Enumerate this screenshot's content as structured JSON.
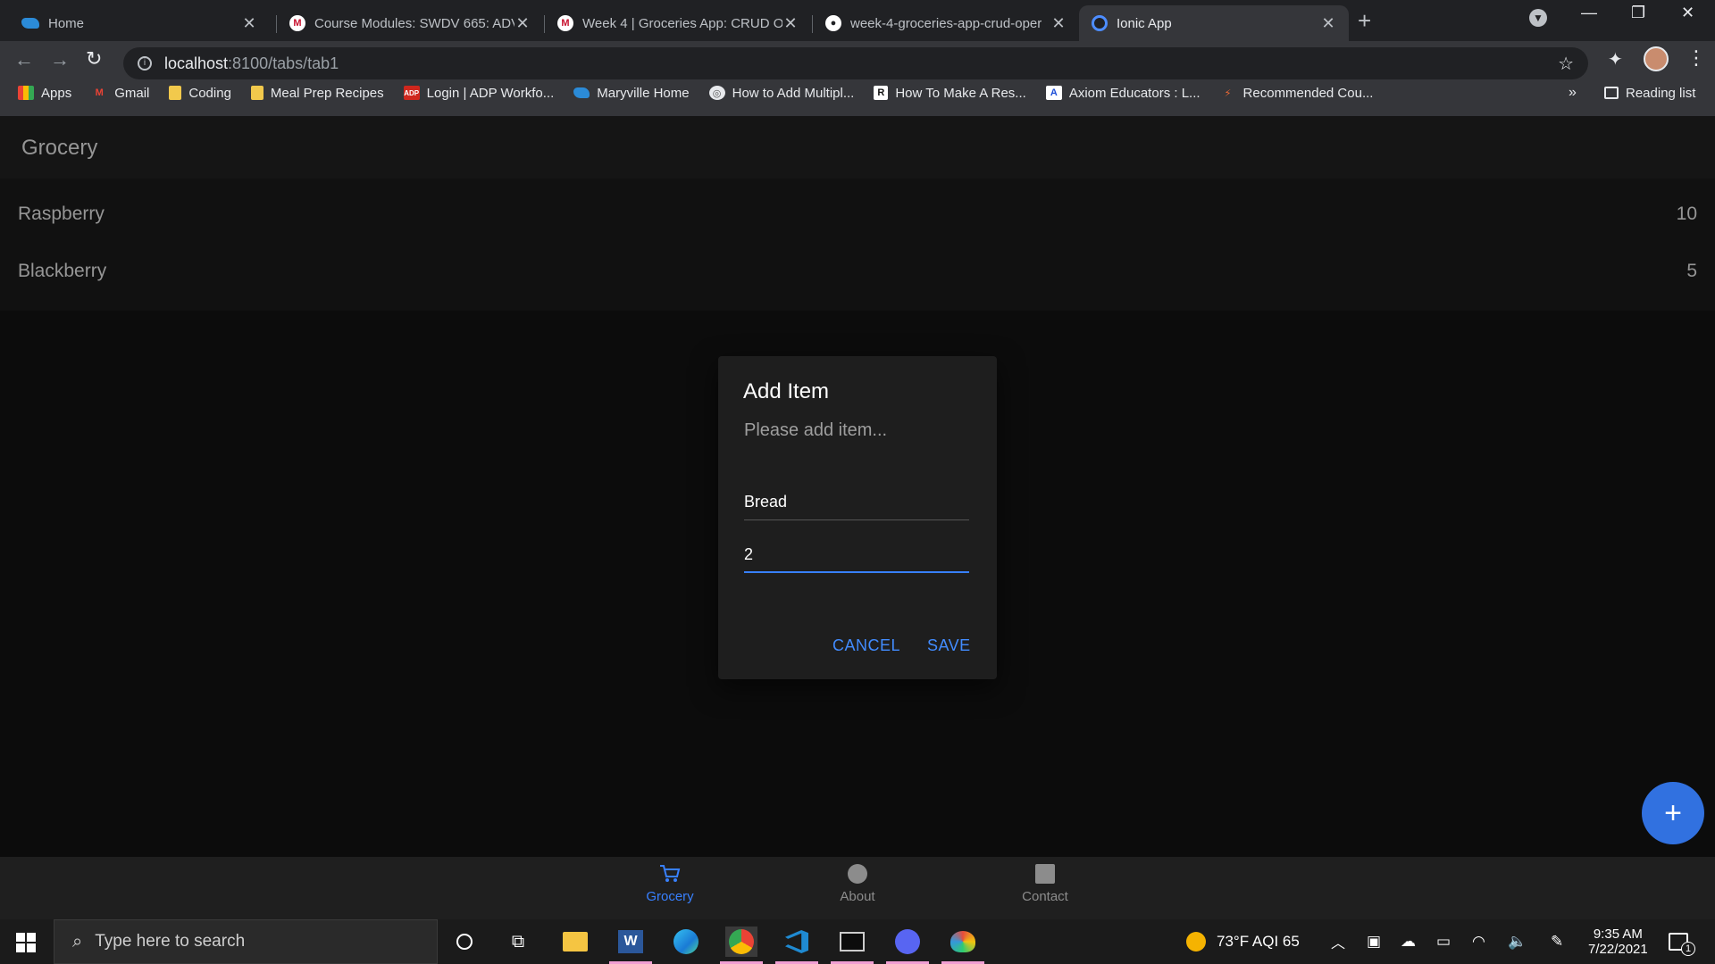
{
  "browser": {
    "tabs": [
      {
        "title": "Home",
        "active": false,
        "favicon": "cloud-icon"
      },
      {
        "title": "Course Modules: SWDV 665: ADV",
        "active": false,
        "favicon": "maryville-icon"
      },
      {
        "title": "Week 4 | Groceries App: CRUD Op",
        "active": false,
        "favicon": "maryville-icon"
      },
      {
        "title": "week-4-groceries-app-crud-oper",
        "active": false,
        "favicon": "github-icon"
      },
      {
        "title": "Ionic App",
        "active": true,
        "favicon": "ionic-icon"
      }
    ],
    "url_host": "localhost",
    "url_path": ":8100/tabs/tab1",
    "bookmarks": [
      {
        "label": "Apps",
        "icon": "apps-grid-icon"
      },
      {
        "label": "Gmail",
        "icon": "gmail-icon"
      },
      {
        "label": "Coding",
        "icon": "folder-icon"
      },
      {
        "label": "Meal Prep Recipes",
        "icon": "folder-icon"
      },
      {
        "label": "Login | ADP Workfo...",
        "icon": "adp-icon"
      },
      {
        "label": "Maryville Home",
        "icon": "cloud-icon"
      },
      {
        "label": "How to Add Multipl...",
        "icon": "site-icon"
      },
      {
        "label": "How To Make A Res...",
        "icon": "r-icon"
      },
      {
        "label": "Axiom Educators : L...",
        "icon": "axiom-icon"
      },
      {
        "label": "Recommended Cou...",
        "icon": "bolt-icon"
      }
    ],
    "more_bookmarks": "»",
    "reading_list": "Reading list"
  },
  "app": {
    "title": "Grocery",
    "items": [
      {
        "name": "Raspberry",
        "quantity": "10"
      },
      {
        "name": "Blackberry",
        "quantity": "5"
      }
    ],
    "fab_label": "+",
    "tabs": [
      {
        "label": "Grocery",
        "icon": "cart-icon",
        "selected": true
      },
      {
        "label": "About",
        "icon": "circle-icon",
        "selected": false
      },
      {
        "label": "Contact",
        "icon": "square-icon",
        "selected": false
      }
    ]
  },
  "dialog": {
    "title": "Add Item",
    "message": "Please add item...",
    "name_value": "Bread",
    "quantity_value": "2",
    "cancel_label": "CANCEL",
    "save_label": "SAVE"
  },
  "taskbar": {
    "search_placeholder": "Type here to search",
    "weather": "73°F  AQI 65",
    "time": "9:35 AM",
    "date": "7/22/2021",
    "notification_count": "1"
  },
  "colors": {
    "accent": "#3880ff",
    "fab": "#3171e0",
    "app_background": "#121212"
  }
}
